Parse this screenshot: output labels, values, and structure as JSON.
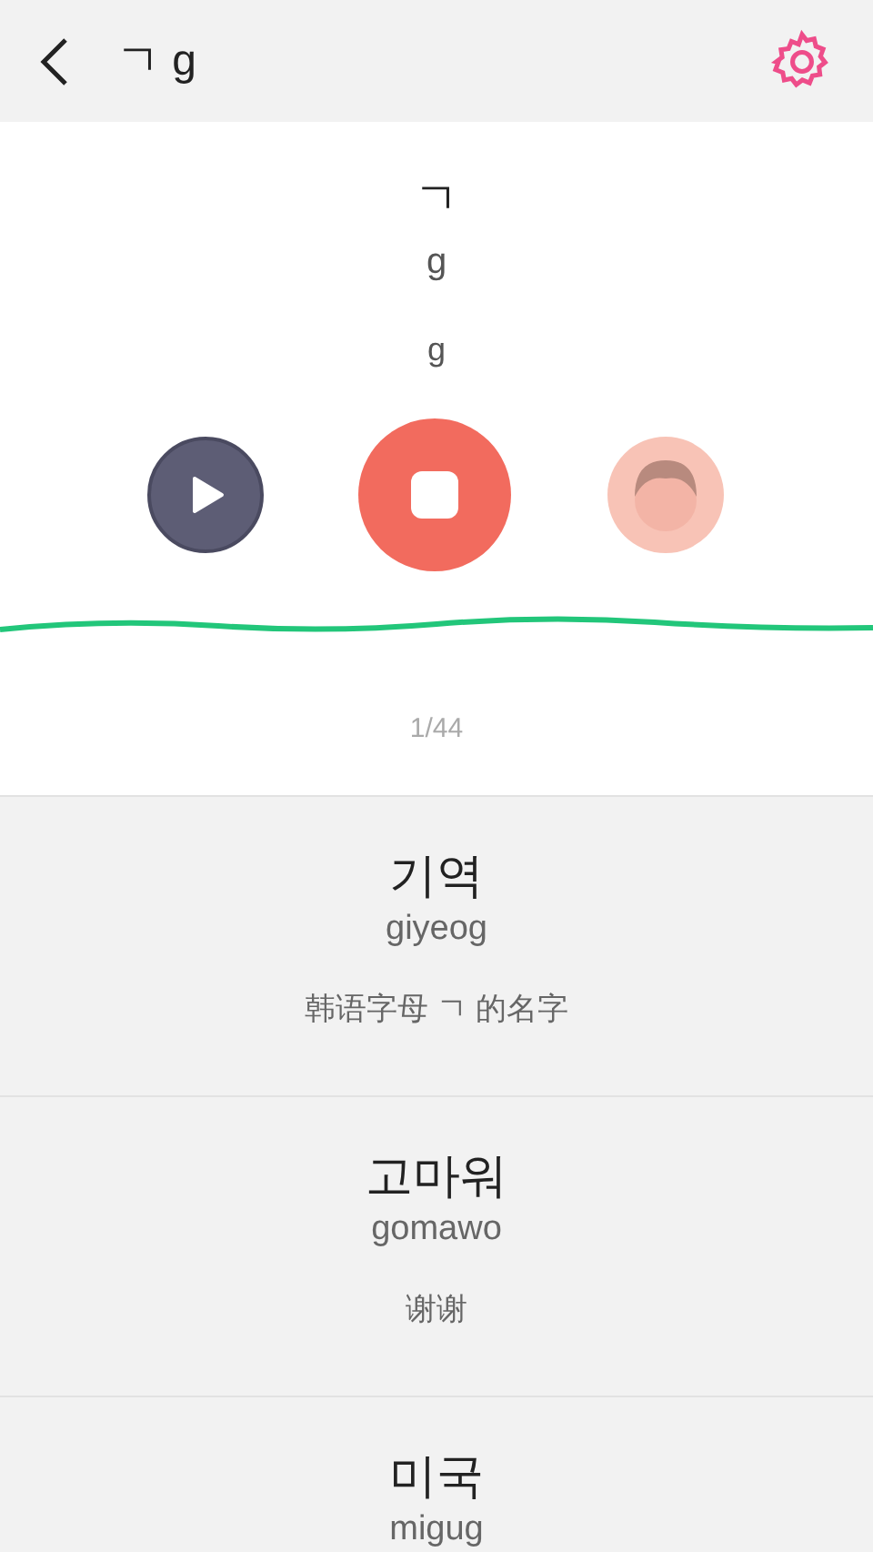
{
  "header": {
    "title": "ㄱ g"
  },
  "card": {
    "letter": "ㄱ",
    "romanization": "g",
    "pronunciation": "g",
    "counter": "1/44"
  },
  "words": [
    {
      "word": "기역",
      "romanization": "giyeog",
      "meaning": "韩语字母 ㄱ 的名字"
    },
    {
      "word": "고마워",
      "romanization": "gomawo",
      "meaning": "谢谢"
    },
    {
      "word": "미국",
      "romanization": "migug"
    }
  ]
}
